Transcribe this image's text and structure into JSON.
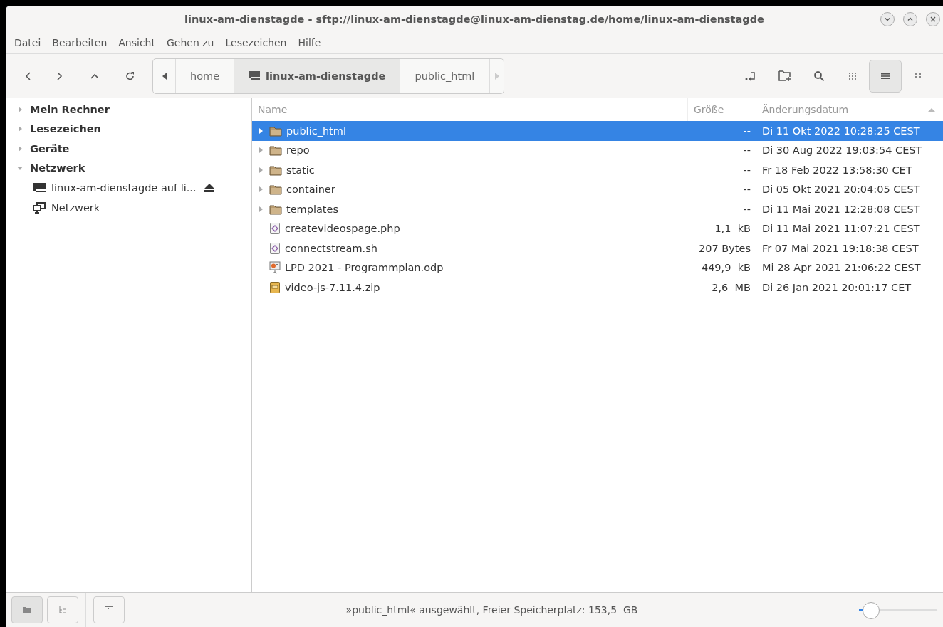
{
  "window": {
    "title": "linux-am-dienstagde - sftp://linux-am-dienstagde@linux-am-dienstag.de/home/linux-am-dienstagde"
  },
  "menu": [
    "Datei",
    "Bearbeiten",
    "Ansicht",
    "Gehen zu",
    "Lesezeichen",
    "Hilfe"
  ],
  "breadcrumbs": [
    {
      "label": "home",
      "selected": false,
      "kind": "plain"
    },
    {
      "label": "linux-am-dienstagde",
      "selected": true,
      "kind": "remote"
    },
    {
      "label": "public_html",
      "selected": false,
      "kind": "plain"
    }
  ],
  "view_buttons": [
    {
      "kind": "icons",
      "selected": false
    },
    {
      "kind": "list",
      "selected": true
    },
    {
      "kind": "compact",
      "selected": false
    }
  ],
  "sidebar": {
    "items": [
      {
        "label": "Mein Rechner",
        "expanded": false
      },
      {
        "label": "Lesezeichen",
        "expanded": false
      },
      {
        "label": "Geräte",
        "expanded": false
      },
      {
        "label": "Netzwerk",
        "expanded": true,
        "children": [
          {
            "label": "linux-am-dienstagde auf li...",
            "kind": "remote",
            "ejectable": true
          },
          {
            "label": "Netzwerk",
            "kind": "network",
            "ejectable": false
          }
        ]
      }
    ]
  },
  "table": {
    "columns": [
      "Name",
      "Größe",
      "Änderungsdatum"
    ],
    "rows": [
      {
        "name": "public_html",
        "size": "--",
        "date": "Di 11 Okt 2022 10:28:25 CEST",
        "kind": "folder",
        "selected": true
      },
      {
        "name": "repo",
        "size": "--",
        "date": "Di 30 Aug 2022 19:03:54 CEST",
        "kind": "folder",
        "selected": false
      },
      {
        "name": "static",
        "size": "--",
        "date": "Fr 18 Feb 2022 13:58:30 CET",
        "kind": "folder",
        "selected": false
      },
      {
        "name": "container",
        "size": "--",
        "date": "Di 05 Okt 2021 20:04:05 CEST",
        "kind": "folder",
        "selected": false
      },
      {
        "name": "templates",
        "size": "--",
        "date": "Di 11 Mai 2021 12:28:08 CEST",
        "kind": "folder",
        "selected": false
      },
      {
        "name": "createvideospage.php",
        "size": "1,1  kB",
        "date": "Di 11 Mai 2021 11:07:21 CEST",
        "kind": "script",
        "selected": false
      },
      {
        "name": "connectstream.sh",
        "size": "207 Bytes",
        "date": "Fr 07 Mai 2021 19:18:38 CEST",
        "kind": "script",
        "selected": false
      },
      {
        "name": "LPD 2021 - Programmplan.odp",
        "size": "449,9  kB",
        "date": "Mi 28 Apr 2021 21:06:22 CEST",
        "kind": "presentation",
        "selected": false
      },
      {
        "name": "video-js-7.11.4.zip",
        "size": "2,6  MB",
        "date": "Di 26 Jan 2021 20:01:17 CET",
        "kind": "archive",
        "selected": false
      }
    ]
  },
  "status_bar": {
    "pane_buttons": [
      {
        "kind": "places",
        "selected": true
      },
      {
        "kind": "tree",
        "selected": false
      }
    ],
    "text": "»public_html« ausgewählt, Freier Speicherplatz: 153,5  GB",
    "zoom": {
      "level": 0.05
    }
  }
}
